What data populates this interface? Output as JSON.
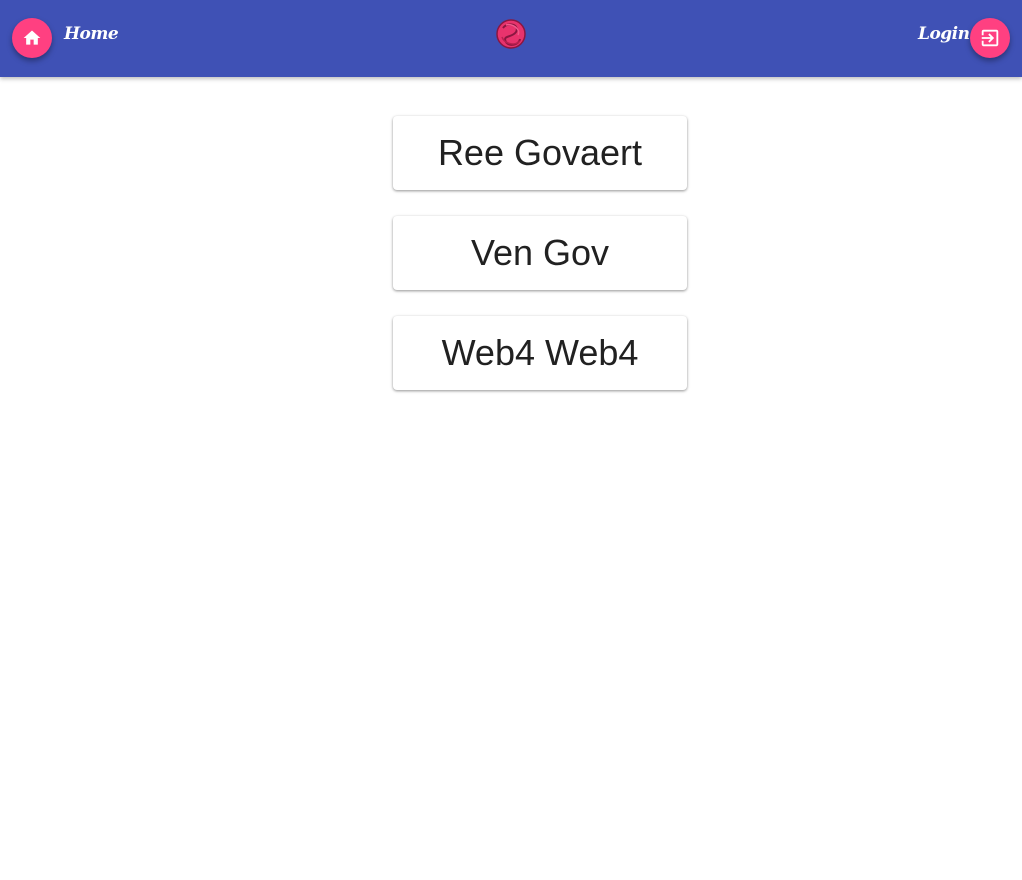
{
  "header": {
    "home_label": "Home",
    "login_label": "Login",
    "home_icon": "home-icon",
    "login_icon": "login-icon",
    "logo_icon": "pink-swirl-logo",
    "bar_color": "#3f51b5",
    "accent_color": "#ff4081"
  },
  "main": {
    "names": [
      {
        "label": "Ree Govaert"
      },
      {
        "label": "Ven Gov"
      },
      {
        "label": "Web4 Web4"
      }
    ]
  }
}
